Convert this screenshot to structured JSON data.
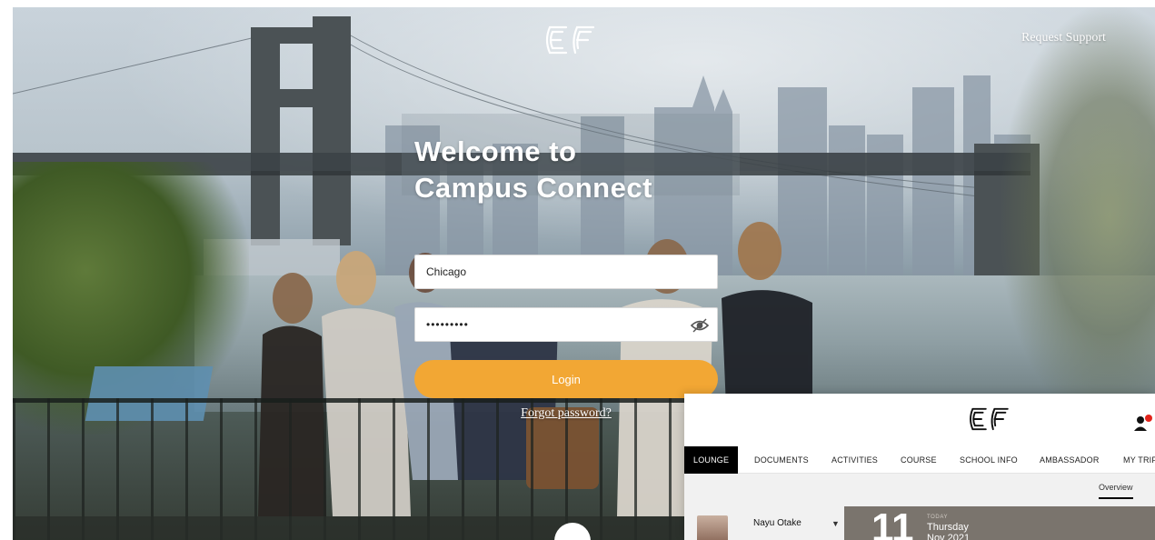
{
  "login": {
    "header": {
      "logo_icon": "ef-logo-icon",
      "request_support_label": "Request Support"
    },
    "welcome_line1": "Welcome to",
    "welcome_line2": "Campus Connect",
    "username": {
      "value": "Chicago",
      "placeholder": ""
    },
    "password": {
      "value": "•••••••••",
      "toggle_icon": "eye-icon"
    },
    "login_button_label": "Login",
    "forgot_password_label": "Forgot password?"
  },
  "app_preview": {
    "logo_icon": "ef-logo-icon",
    "notification_icon": "user-notification-icon",
    "nav_tabs": [
      {
        "label": "LOUNGE",
        "active": true
      },
      {
        "label": "DOCUMENTS",
        "active": false
      },
      {
        "label": "ACTIVITIES",
        "active": false
      },
      {
        "label": "COURSE",
        "active": false
      },
      {
        "label": "SCHOOL INFO",
        "active": false
      },
      {
        "label": "AMBASSADOR",
        "active": false
      },
      {
        "label": "MY TRIP",
        "active": false
      }
    ],
    "sub_tab_label": "Overview",
    "user_name": "Nayu Otake",
    "date": {
      "day_number": "11",
      "today_label": "TODAY",
      "weekday": "Thursday",
      "month_year": "Nov 2021"
    }
  },
  "colors": {
    "login_button": "#f2a734",
    "nav_active_bg": "#000000",
    "date_card_bg": "#7a746d"
  }
}
